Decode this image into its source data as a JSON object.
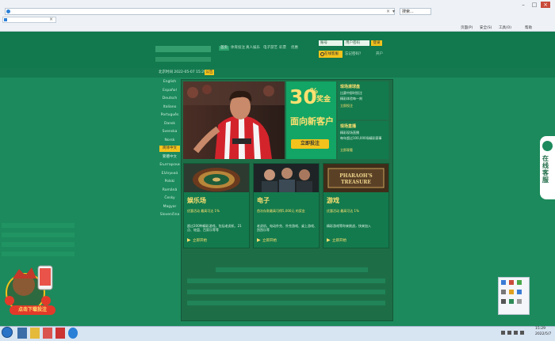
{
  "browser": {
    "address_text": "",
    "search_placeholder": "搜索...",
    "tab_title": "",
    "commands": [
      "页面(P)",
      "安全(S)",
      "工具(O)",
      "帮助"
    ]
  },
  "header": {
    "nav": [
      "首页",
      "体育投注",
      "真人娱乐",
      "电子游艺",
      "彩票",
      "优惠"
    ],
    "login_account_placeholder": "账号",
    "login_password_placeholder": "用户密码",
    "login_button": "登录",
    "cs_button": "在线客服",
    "links": [
      "忘记密码？",
      "开户"
    ],
    "clock": "北京时间 2022-05-07 15:29:32",
    "announce": "公告"
  },
  "languages": [
    "English",
    "Español",
    "Deutsch",
    "Italiano",
    "Português",
    "Dansk",
    "Svenska",
    "Norsk",
    "简体中文",
    "繁體中文",
    "Български",
    "Ελληνικά",
    "Polski",
    "Română",
    "Česky",
    "Magyar",
    "Slovenčina"
  ],
  "languages_active_index": 8,
  "promo": {
    "pct": "30",
    "pct_unit": "%",
    "bonus": "奖金",
    "title": "面向新客户",
    "join": "立即投注"
  },
  "info_boxes": [
    {
      "title": "现场滚球盘",
      "lines": [
        "比赛中即时投注",
        "精彩体验每一刻",
        "立即投注"
      ],
      "link": ""
    },
    {
      "title": "现场直播",
      "lines": [
        "精彩现场直播",
        "每年超过100,000场精彩赛事",
        "立即观看"
      ],
      "link": ""
    }
  ],
  "cards": [
    {
      "title": "娱乐场",
      "highlight": "优惠活动 最高可达 1%",
      "desc": "超过200种精彩游戏，包括老虎机、21点、轮盘、百家乐等等",
      "link": "立即开始"
    },
    {
      "title": "电子",
      "highlight": "首次存款最高可得5,000元 的奖金",
      "desc": "老虎机、电动扑克、扑克游戏、桌上游戏、刮刮乐等",
      "link": "立即开始"
    },
    {
      "title": "游戏",
      "highlight": "优惠活动 最高可达 1%",
      "desc": "精彩游戏等你来挑战，快来加入",
      "link": "立即开始"
    }
  ],
  "card3_banner": "PHARAOH'S TREASURE",
  "side_cs": "在线客服",
  "download": "点击下载投注",
  "taskbar_time": "15:29",
  "taskbar_date": "2022/5/7",
  "colors": {
    "page_bg": "#1c8a5c",
    "accent": "#f3c21c",
    "promo_bg": "#12a565"
  }
}
